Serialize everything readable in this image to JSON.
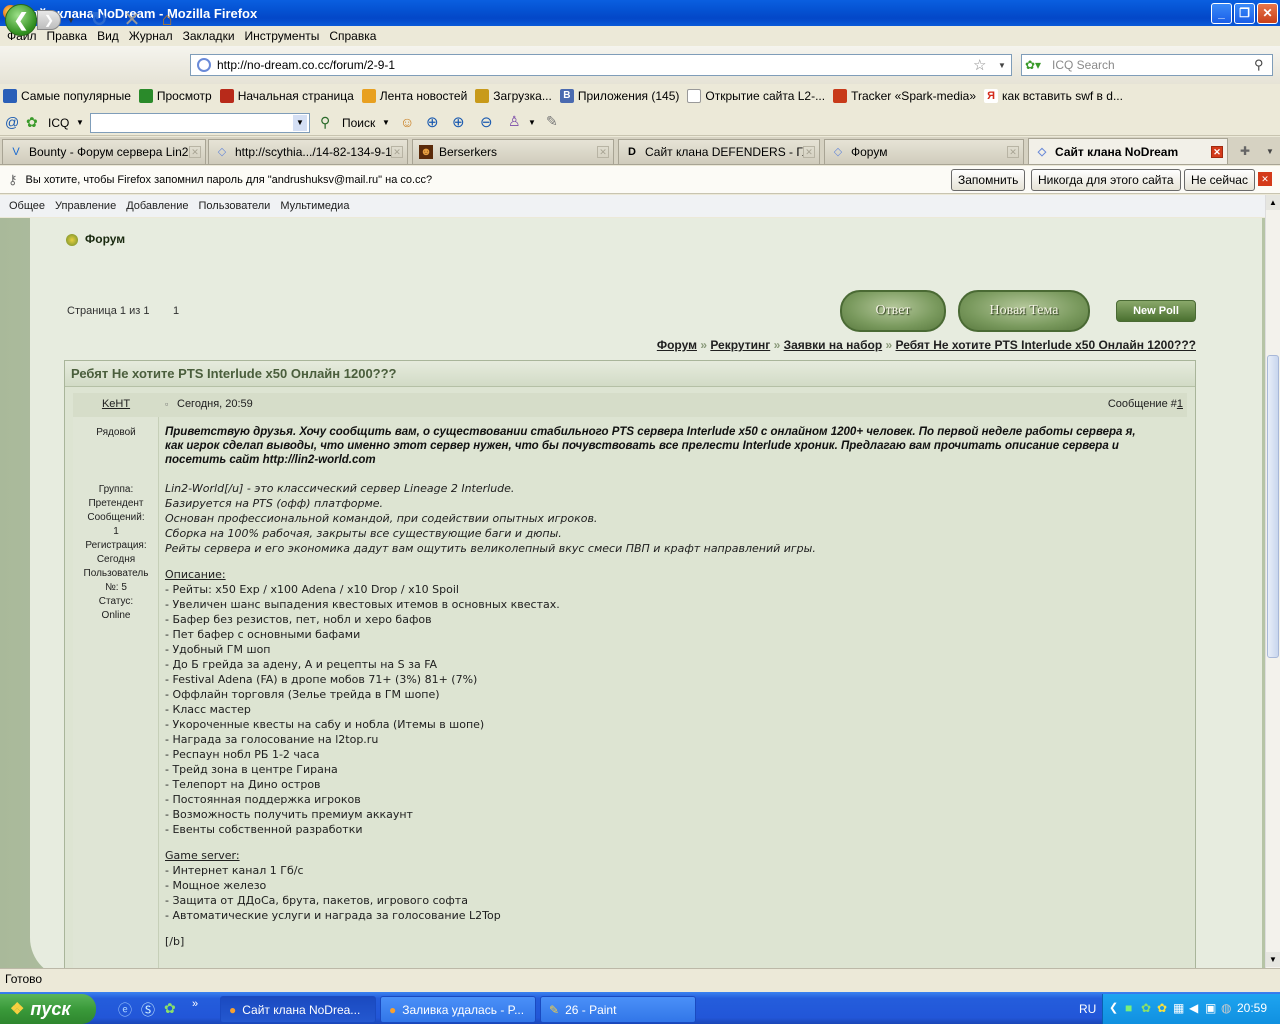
{
  "window": {
    "title": "Сайт клана NoDream - Mozilla Firefox"
  },
  "menu": [
    "Файл",
    "Правка",
    "Вид",
    "Журнал",
    "Закладки",
    "Инструменты",
    "Справка"
  ],
  "nav": {
    "url": "http://no-dream.co.cc/forum/2-9-1",
    "search_placeholder": "ICQ Search"
  },
  "bookmarks": [
    {
      "label": "Самые популярные",
      "color": "#2a5fb8"
    },
    {
      "label": "Просмотр",
      "color": "#2a8a2a"
    },
    {
      "label": "Начальная страница",
      "color": "#b82a1a"
    },
    {
      "label": "Лента новостей",
      "color": "#e8a020"
    },
    {
      "label": "Загрузка...",
      "color": "#c89a1a"
    },
    {
      "label": "Приложения (145)",
      "color": "#4a6ab0"
    },
    {
      "label": "Открытие сайта L2-...",
      "color": "#ffffff"
    },
    {
      "label": "Tracker «Spark-media»",
      "color": "#c83a1a"
    },
    {
      "label": "как вставить swf в d...",
      "color": "#d42a1a"
    }
  ],
  "icq": {
    "label": "ICQ",
    "search_button": "Поиск"
  },
  "tabs": [
    {
      "label": "Bounty - Форум сервера Lin2...",
      "icon": "V"
    },
    {
      "label": "http://scythia.../14-82-134-9-1",
      "icon": "◇"
    },
    {
      "label": "Berserkers",
      "icon": "☻"
    },
    {
      "label": "Сайт клана DEFENDERS - Гл...",
      "icon": "D"
    },
    {
      "label": "Форум",
      "icon": "◇"
    },
    {
      "label": "Сайт клана NoDream",
      "icon": "◇"
    }
  ],
  "notification": {
    "text": "Вы хотите, чтобы Firefox запомнил пароль для \"andrushuksv@mail.ru\" на co.cc?",
    "remember": "Запомнить",
    "never": "Никогда для этого сайта",
    "not_now": "Не сейчас"
  },
  "site_menu": [
    "Общее",
    "Управление",
    "Добавление",
    "Пользователи",
    "Мультимедиа"
  ],
  "forum": {
    "header": "Форум",
    "page_info": "Страница 1 из 1",
    "page_link": "1",
    "reply_button": "Ответ",
    "new_topic_button": "Новая Тема",
    "new_poll_button": "New Poll",
    "breadcrumb": [
      "Форум",
      "Рекрутинг",
      "Заявки на набор",
      "Ребят Не хотите PTS Interlude x50 Онлайн 1200???"
    ],
    "breadcrumb_sep": "»",
    "topic_title": "Ребят Не хотите PTS Interlude x50 Онлайн 1200???"
  },
  "post": {
    "author": "KeHT",
    "date": "Сегодня, 20:59",
    "msg_label": "Сообщение #",
    "msg_num": "1",
    "rank": "Рядовой",
    "user_info": [
      "Группа:",
      "Претендент",
      "Сообщений:",
      "1",
      "Регистрация:",
      "Сегодня",
      "Пользователь",
      "№: 5",
      "Статус:",
      "Online"
    ],
    "intro": "Приветствую друзья. Хочу сообщить вам, о существовании стабильного PTS сервера Interlude x50 с онлайном 1200+ человек. По первой неделе работы сервера я, как игрок сделап выводы, что именно этот сервер нужен, что бы почувствовать все прелести Interlude хроник. Предлагаю вам прочитать описание сервера и посетить сайт http://lin2-world.com",
    "italic_lines": [
      "Lin2-World[/u] - это классический сервер Lineage 2 Interlude.",
      "Базируется на PTS (офф) платформе.",
      "Основан профессиональной командой, при содействии опытных игроков.",
      "Сборка на 100% рабочая, закрыты все существующие баги и дюпы.",
      "Рейты сервера и его экономика дадут вам ощутить великолепный вкус смеси ПВП и крафт направлений игры."
    ],
    "desc_heading": "Описание:",
    "desc_lines": [
      "- Рейты: x50 Exp / x100 Adena / x10 Drop / x10 Spoil",
      "- Увеличен шанс выпадения квестовых итемов в основных квестах.",
      "- Бафер без резистов, пет, нобл и херо бафов",
      "- Пет бафер с основными бафами",
      "- Удобный ГМ шоп",
      "- До Б грейда за адену, А и рецепты на S за FA",
      "- Festival Adena (FA) в дропе мобов 71+ (3%) 81+ (7%)",
      "- Оффлайн торговля (Зелье трейда в ГМ шопе)",
      "- Класс мастер",
      "- Укороченные квесты на сабу и нобла (Итемы в шопе)",
      "- Награда за голосование на l2top.ru",
      "- Респаун нобл РБ 1-2 часа",
      "- Трейд зона в центре Гирана",
      "- Телепорт на Дино остров",
      "- Постоянная поддержка игроков",
      "- Возможность получить премиум аккаунт",
      "- Евенты собственной разработки"
    ],
    "game_heading": "Game server:",
    "game_lines": [
      "- Интернет канал 1 Гб/с",
      "- Мощное железо",
      "- Защита от ДДоСа, брута, пакетов, игрового софта",
      "- Автоматические услуги и награда за голосование L2Top"
    ],
    "closing": "[/b]"
  },
  "status": "Готово",
  "taskbar": {
    "start": "пуск",
    "tasks": [
      "Сайт клана NoDrea...",
      "Заливка удалась - P...",
      "26 - Paint"
    ],
    "lang": "RU",
    "time": "20:59"
  },
  "colors": {
    "titlebar": "#0450d0",
    "post_bg": "#dde4d2",
    "link": "#202020",
    "heading": "#4a5e3c"
  }
}
